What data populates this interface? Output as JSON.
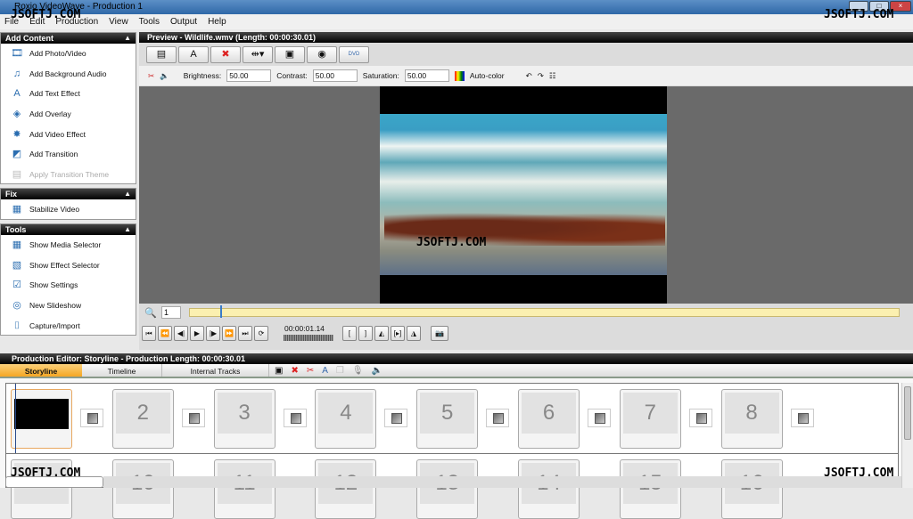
{
  "window": {
    "title": "Roxio VideoWave - Production 1",
    "controls": [
      "_",
      "□",
      "×"
    ]
  },
  "menu": [
    "File",
    "Edit",
    "Production",
    "View",
    "Tools",
    "Output",
    "Help"
  ],
  "watermark": "JSOFTJ.COM",
  "add_content": {
    "title": "Add Content",
    "items": [
      {
        "label": "Add Photo/Video",
        "icon": "add-photo-video-icon",
        "glyph": "🎞"
      },
      {
        "label": "Add Background Audio",
        "icon": "add-audio-icon",
        "glyph": "♫"
      },
      {
        "label": "Add Text Effect",
        "icon": "add-text-icon",
        "glyph": "A"
      },
      {
        "label": "Add Overlay",
        "icon": "add-overlay-icon",
        "glyph": "◈"
      },
      {
        "label": "Add Video Effect",
        "icon": "add-video-effect-icon",
        "glyph": "✸"
      },
      {
        "label": "Add Transition",
        "icon": "add-transition-icon",
        "glyph": "◩"
      },
      {
        "label": "Apply Transition Theme",
        "icon": "transition-theme-icon",
        "glyph": "▤",
        "disabled": true
      }
    ]
  },
  "fix": {
    "title": "Fix",
    "items": [
      {
        "label": "Stabilize Video",
        "glyph": "▦"
      }
    ]
  },
  "tools": {
    "title": "Tools",
    "items": [
      {
        "label": "Show Media Selector",
        "glyph": "▦"
      },
      {
        "label": "Show Effect Selector",
        "glyph": "▧"
      },
      {
        "label": "Show Settings",
        "glyph": "☑"
      },
      {
        "label": "New Slideshow",
        "glyph": "◎"
      },
      {
        "label": "Capture/Import",
        "glyph": "⌷"
      }
    ]
  },
  "preview": {
    "title": "Preview - Wildlife.wmv (Length: 00:00:30.01)",
    "toolbar_glyphs": [
      "▤",
      "A",
      "✖",
      "⇹▾",
      "▣",
      "◉",
      "DVD"
    ],
    "brightness_label": "Brightness:",
    "brightness": "50.00",
    "contrast_label": "Contrast:",
    "contrast": "50.00",
    "saturation_label": "Saturation:",
    "saturation": "50.00",
    "autocolor_label": "Auto-color",
    "frame_value": "1",
    "position_fraction": 0.043,
    "timecode": "00:00:01.14",
    "transport": [
      "⏮",
      "⏪",
      "◀|",
      "▶",
      "|▶",
      "⏩",
      "⏭",
      "⟳"
    ],
    "mark_buttons": [
      "[",
      "]",
      "◭",
      "[▸]",
      "◮"
    ]
  },
  "editor": {
    "title": "Production Editor: Storyline - Production Length: 00:00:30.01",
    "tabs": [
      "Storyline",
      "Timeline",
      "Internal Tracks"
    ],
    "active_tab": "Storyline",
    "tiles_row1": [
      "",
      "2",
      "3",
      "4",
      "5",
      "6",
      "7",
      "8"
    ],
    "tiles_row2": [
      "",
      "10",
      "11",
      "12",
      "13",
      "14",
      "15",
      "16"
    ]
  },
  "colors": {
    "accent": "#f5b23b",
    "header": "#000000",
    "timeline": "#fbf0b0"
  }
}
